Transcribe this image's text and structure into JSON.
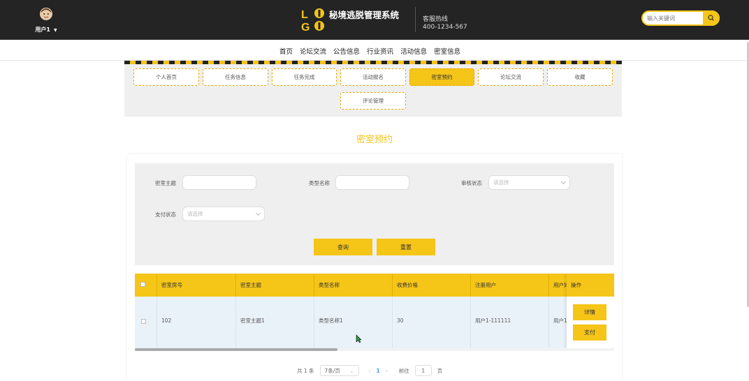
{
  "header": {
    "user_label": "用户1",
    "site_title": "秘境逃脱管理系统",
    "hotline_label": "客服热线",
    "hotline_number": "400-1234-567",
    "search_placeholder": "输入关键词"
  },
  "nav": [
    "首页",
    "论坛交流",
    "公告信息",
    "行业资讯",
    "活动信息",
    "密室信息"
  ],
  "user_menu": [
    "个人首页",
    "任务信息",
    "任务完成",
    "活动报名",
    "密室预约",
    "论坛交流",
    "收藏",
    "评论管理"
  ],
  "active_menu": "密室预约",
  "page_title": "密室预约",
  "filter": {
    "theme_label": "密室主题",
    "type_label": "类型名称",
    "audit_label": "审核状态",
    "audit_placeholder": "请选择",
    "pay_label": "支付状态",
    "pay_placeholder": "请选择",
    "query_label": "查询",
    "reset_label": "重置"
  },
  "table": {
    "columns": [
      "密室房号",
      "密室主题",
      "类型名称",
      "收费价格",
      "注册用户",
      "用户姓名",
      "操作"
    ],
    "visible_column_fragment": "用户如",
    "rows": [
      {
        "room": "102",
        "theme": "密室主题1",
        "type": "类型名称1",
        "price": "30",
        "user": "用户1-111111",
        "name_fragment": "用户1"
      }
    ],
    "detail_label": "详情",
    "pay_label": "支付"
  },
  "pagination": {
    "total": "共 1 条",
    "page_size": "7条/页",
    "current_page": "1",
    "goto_label": "前往",
    "goto_value": "1",
    "page_unit": "页"
  },
  "colors": {
    "accent": "#f5c518",
    "header_bg": "#242424"
  }
}
